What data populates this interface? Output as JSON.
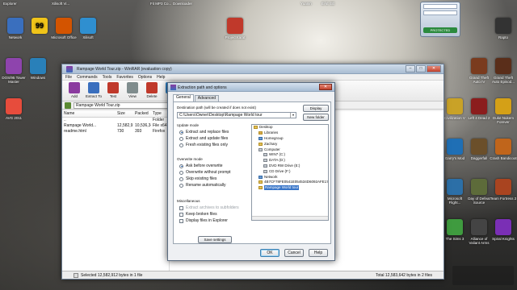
{
  "top_strip": [
    "Explorer",
    "Xilisoft Vi...",
    "Fit MP3 Co...",
    "Downloader",
    "Yuanin",
    "ÉÄÈ ÈÉ"
  ],
  "gadget": {
    "go_label": "PROTECTED"
  },
  "desktop_left": [
    {
      "label": "Network",
      "icon": "network-icon",
      "color": "#3a6fbe"
    },
    {
      "label": "99",
      "icon": "app-99-icon",
      "color": "#f0c419"
    },
    {
      "label": "Microsoft Office",
      "icon": "office-icon",
      "color": "#d35400"
    },
    {
      "label": "Xilisoft",
      "icon": "xilisoft-icon",
      "color": "#2f8fd0"
    },
    {
      "label": "ProjectKarat",
      "icon": "pt-icon",
      "color": "#c0392b"
    },
    {
      "label": "DOS/95 Tower Master",
      "icon": "game-icon",
      "color": "#8e44ad"
    },
    {
      "label": "Windows",
      "icon": "windows-icon",
      "color": "#2980b9"
    },
    {
      "label": "AVG 2011",
      "icon": "avg-icon",
      "color": "#e74c3c"
    }
  ],
  "desktop_right": [
    {
      "label": "Rapto",
      "icon": "rapto-icon",
      "color": "#333"
    },
    {
      "label": "Grand Theft Auto IV",
      "icon": "gta-icon",
      "color": "#7a3b1e"
    },
    {
      "label": "Grand Theft Auto Episod...",
      "icon": "gta-icon",
      "color": "#5a2e1a"
    },
    {
      "label": "Civilization V",
      "icon": "civ-icon",
      "color": "#c9a227"
    },
    {
      "label": "Left 4 Dead 2",
      "icon": "l4d2-icon",
      "color": "#8b1d1d"
    },
    {
      "label": "Duke Nukem Forever",
      "icon": "duke-icon",
      "color": "#d4a017"
    },
    {
      "label": "Garry's Mod",
      "icon": "gmod-icon",
      "color": "#1f6fb5"
    },
    {
      "label": "Daggerfall",
      "icon": "daggerfall-icon",
      "color": "#6b4f2a"
    },
    {
      "label": "Crash Bandicoot",
      "icon": "crash-icon",
      "color": "#c0651b"
    },
    {
      "label": "Microsoft Flight...",
      "icon": "flight-icon",
      "color": "#2c6fa7"
    },
    {
      "label": "Day of Defeat Source",
      "icon": "dod-icon",
      "color": "#5d6b3a"
    },
    {
      "label": "Team Fortress 2",
      "icon": "tf2-icon",
      "color": "#a94420"
    },
    {
      "label": "The Sims 3",
      "icon": "sims-icon",
      "color": "#3f9b3f"
    },
    {
      "label": "Alliance of Valiant Arms",
      "icon": "ava-icon",
      "color": "#444"
    },
    {
      "label": "Spiral Knights",
      "icon": "sk-icon",
      "color": "#7a2fb5"
    }
  ],
  "winrar": {
    "title": "Rampage World Tour.zip - WinRAR (evaluation copy)",
    "menu": [
      "File",
      "Commands",
      "Tools",
      "Favorites",
      "Options",
      "Help"
    ],
    "toolbar": [
      {
        "label": "Add",
        "icon": "add-icon",
        "color": "#8b3b9f"
      },
      {
        "label": "Extract To",
        "icon": "extract-icon",
        "color": "#3a6fbe"
      },
      {
        "label": "Test",
        "icon": "test-icon",
        "color": "#c0392b"
      },
      {
        "label": "View",
        "icon": "view-icon",
        "color": "#7f8c8d"
      },
      {
        "label": "Delete",
        "icon": "delete-icon",
        "color": "#c0392b"
      },
      {
        "label": "Find",
        "icon": "find-icon",
        "color": "#2c82c9"
      }
    ],
    "address": "Rampage World Tour.zip",
    "columns": {
      "name": "Name",
      "size": "Size",
      "packed": "Packed",
      "type": "Type"
    },
    "rows": [
      {
        "name": "..",
        "size": "",
        "packed": "",
        "type": "Folder"
      },
      {
        "name": "Rampage World...",
        "size": "12,582,912",
        "packed": "10,536,348",
        "type": "File x64"
      },
      {
        "name": "readme.html",
        "size": "730",
        "packed": "393",
        "type": "Firefox"
      }
    ],
    "status_left": "Selected 12,582,912 bytes in 1 file",
    "status_right": "Total 12,583,642 bytes in 2 files"
  },
  "dialog": {
    "title": "Extraction path and options",
    "tabs": [
      "General",
      "Advanced"
    ],
    "dest_label": "Destination path (will be created if does not exist)",
    "dest_value": "C:\\Users\\Owner\\Desktop\\Rampage World tour",
    "display_btn": "Display",
    "new_folder_btn": "New folder",
    "update_mode": {
      "title": "Update mode",
      "options": [
        "Extract and replace files",
        "Extract and update files",
        "Fresh existing files only"
      ]
    },
    "overwrite_mode": {
      "title": "Overwrite mode",
      "options": [
        "Ask before overwrite",
        "Overwrite without prompt",
        "Skip existing files",
        "Rename automatically"
      ]
    },
    "misc": {
      "title": "Miscellaneous",
      "options": [
        "Extract archives to subfolders",
        "Keep broken files",
        "Display files in Explorer"
      ]
    },
    "save_btn": "Save settings",
    "tree": [
      {
        "label": "Desktop",
        "indent": 0,
        "kind": "folder"
      },
      {
        "label": "Libraries",
        "indent": 1,
        "kind": "lib"
      },
      {
        "label": "Homegroup",
        "indent": 1,
        "kind": "net"
      },
      {
        "label": "Zachary",
        "indent": 1,
        "kind": "folder"
      },
      {
        "label": "Computer",
        "indent": 1,
        "kind": "drive"
      },
      {
        "label": "WIN7 (C:)",
        "indent": 2,
        "kind": "drive"
      },
      {
        "label": "DATA (D:)",
        "indent": 2,
        "kind": "drive"
      },
      {
        "label": "DVD RW Drive (E:)",
        "indent": 2,
        "kind": "drive"
      },
      {
        "label": "CD Drive (F:)",
        "indent": 2,
        "kind": "drive"
      },
      {
        "label": "Network",
        "indent": 1,
        "kind": "net"
      },
      {
        "label": "4B7CF78FE0541E054534D6092AFE17",
        "indent": 1,
        "kind": "folder"
      },
      {
        "label": "Rampage World tour",
        "indent": 1,
        "kind": "folder",
        "selected": true
      }
    ],
    "ok": "OK",
    "cancel": "Cancel",
    "help": "Help"
  }
}
